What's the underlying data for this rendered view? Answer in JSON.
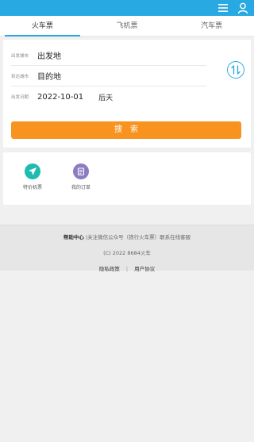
{
  "header": {
    "menu_icon": "menu-icon",
    "user_icon": "user-icon",
    "bg_color": "#29a9e1"
  },
  "tabs": [
    {
      "label": "火车票",
      "active": true
    },
    {
      "label": "飞机票",
      "active": false
    },
    {
      "label": "汽车票",
      "active": false
    }
  ],
  "form": {
    "from_label": "出发城市",
    "from_value": "出发地",
    "to_label": "到达城市",
    "to_value": "目的地",
    "date_label": "出发日期",
    "date_value": "2022-10-01",
    "day_value": "后天",
    "swap_icon": "swap-icon",
    "search_label": "搜索",
    "search_color": "#f7931e"
  },
  "quick_links": [
    {
      "label": "特价机票",
      "icon": "airplane-icon",
      "color": "#1ebbb0"
    },
    {
      "label": "我的订单",
      "icon": "order-icon",
      "color": "#8e7cc3"
    }
  ],
  "footer": {
    "help": "帮助中心",
    "notice": "|关注微信公众号（铁行火车票）联系在线客服",
    "copyright": "(C) 2022 8684火车",
    "privacy": "隐私政策",
    "separator": "|",
    "agreement": "用户协议"
  }
}
